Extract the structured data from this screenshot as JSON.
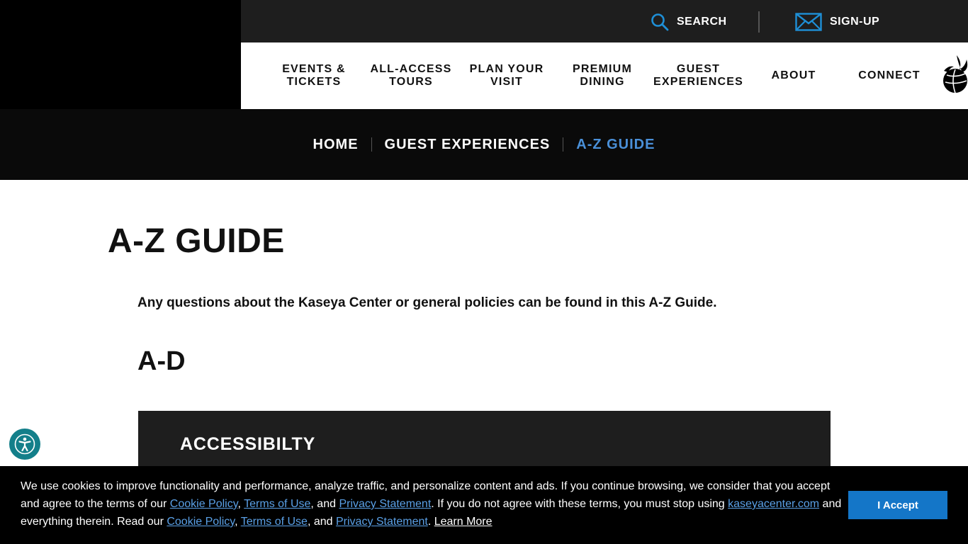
{
  "header": {
    "search_label": "SEARCH",
    "signup_label": "SIGN-UP",
    "nav": [
      {
        "label": "EVENTS &\nTICKETS"
      },
      {
        "label": "ALL-ACCESS\nTOURS"
      },
      {
        "label": "PLAN YOUR\nVISIT"
      },
      {
        "label": "PREMIUM\nDINING"
      },
      {
        "label": "GUEST\nEXPERIENCES"
      },
      {
        "label": "ABOUT"
      },
      {
        "label": "CONNECT"
      }
    ]
  },
  "breadcrumb": {
    "items": [
      "HOME",
      "GUEST EXPERIENCES",
      "A-Z GUIDE"
    ]
  },
  "main": {
    "title": "A-Z GUIDE",
    "intro": "Any questions about the Kaseya Center or general policies can be found in this A-Z Guide.",
    "section_heading": "A-D",
    "accordion_title": "ACCESSIBILTY"
  },
  "cookie": {
    "part1": "We use cookies to improve functionality and performance, analyze traffic, and personalize content and ads. If you continue browsing, we consider that you accept and agree to the terms of our ",
    "cookie_policy": "Cookie Policy",
    "comma1": ", ",
    "terms": "Terms of Use",
    "and1": ", and ",
    "privacy": "Privacy Statement",
    "part2": ". If you do not agree with these terms, you must stop using ",
    "site": "kaseyacenter.com",
    "part3": " and everything therein. Read our ",
    "cookie_policy2": "Cookie Policy",
    "comma2": ", ",
    "terms2": "Terms of Use",
    "and2": ", and ",
    "privacy2": "Privacy Statement",
    "period": ". ",
    "learn_more": "Learn More",
    "accept_label": "I Accept"
  },
  "colors": {
    "accent": "#4a90d9",
    "accept_button": "#1476c8",
    "accessibility_button": "#137f8a"
  }
}
